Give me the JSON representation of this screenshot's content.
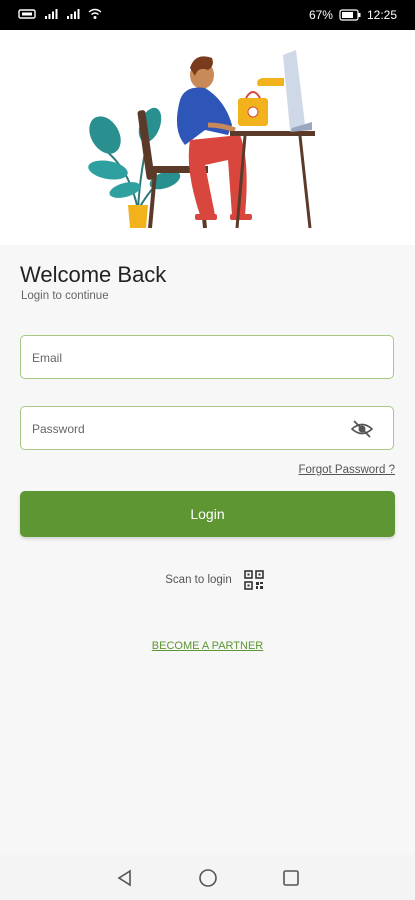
{
  "status_bar": {
    "battery_percent": "67%",
    "time": "12:25"
  },
  "header": {
    "title": "Welcome Back",
    "subtitle": "Login to continue"
  },
  "form": {
    "email_placeholder": "Email",
    "password_placeholder": "Password",
    "forgot_password": "Forgot Password ?",
    "login_label": "Login"
  },
  "scan": {
    "label": "Scan to login"
  },
  "partner": {
    "label": "BECOME A PARTNER"
  },
  "colors": {
    "accent": "#5d9633",
    "field_border": "#a7c883",
    "background": "#f7f7f7"
  },
  "nav": {
    "back_icon": "back-triangle",
    "home_icon": "home-circle",
    "recents_icon": "recents-square"
  }
}
